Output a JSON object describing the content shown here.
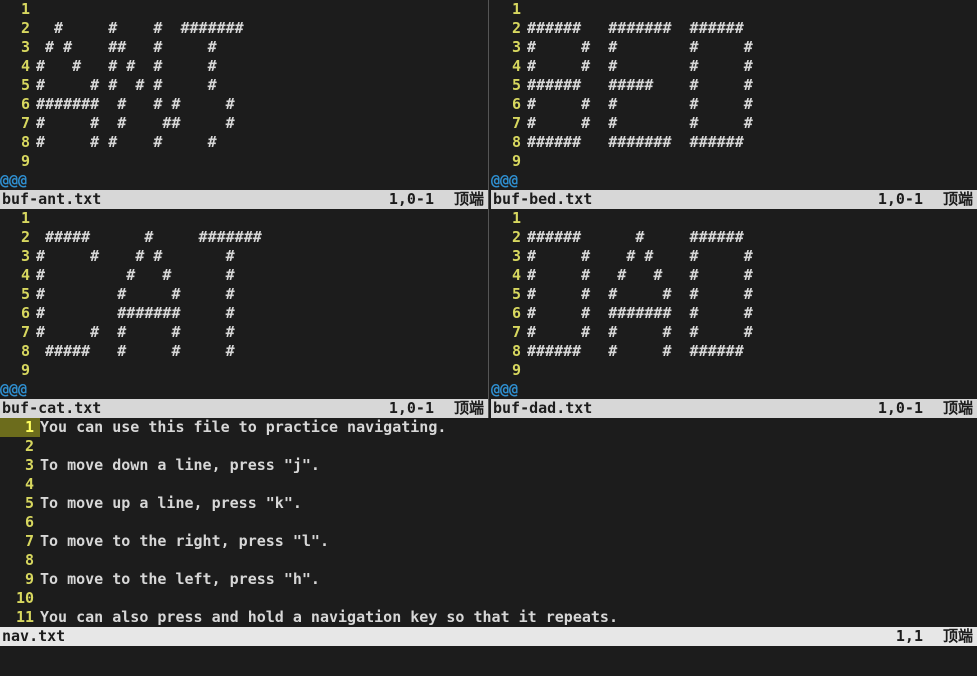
{
  "panes": {
    "ant": {
      "filename": "buf-ant.txt",
      "cursor": "1,0-1",
      "scroll": "顶端",
      "marker": "@@@",
      "lines": [
        "",
        "  #     #    #  #######",
        " # #    ##   #     #",
        "#   #   # #  #     #",
        "#     # #  # #     #",
        "#######  #   # #     #",
        "#     #  #    ##     #",
        "#     # #    #     #",
        ""
      ]
    },
    "bed": {
      "filename": "buf-bed.txt",
      "cursor": "1,0-1",
      "scroll": "顶端",
      "marker": "@@@",
      "lines": [
        "",
        "######   #######  ######",
        "#     #  #        #     #",
        "#     #  #        #     #",
        "######   #####    #     #",
        "#     #  #        #     #",
        "#     #  #        #     #",
        "######   #######  ######",
        ""
      ]
    },
    "cat": {
      "filename": "buf-cat.txt",
      "cursor": "1,0-1",
      "scroll": "顶端",
      "marker": "@@@",
      "lines": [
        "",
        " #####      #     #######",
        "#     #    # #       #",
        "#         #   #      #",
        "#        #     #     #",
        "#        #######     #",
        "#     #  #     #     #",
        " #####   #     #     #",
        ""
      ]
    },
    "dad": {
      "filename": "buf-dad.txt",
      "cursor": "1,0-1",
      "scroll": "顶端",
      "marker": "@@@",
      "lines": [
        "",
        "######      #     ######",
        "#     #    # #    #     #",
        "#     #   #   #   #     #",
        "#     #  #     #  #     #",
        "#     #  #######  #     #",
        "#     #  #     #  #     #",
        "######   #     #  ######",
        ""
      ]
    },
    "nav": {
      "filename": "nav.txt",
      "cursor": "1,1",
      "scroll": "顶端",
      "lines": [
        "You can use this file to practice navigating.",
        "",
        "To move down a line, press \"j\".",
        "",
        "To move up a line, press \"k\".",
        "",
        "To move to the right, press \"l\".",
        "",
        "To move to the left, press \"h\".",
        "",
        "You can also press and hold a navigation key so that it repeats."
      ]
    }
  }
}
